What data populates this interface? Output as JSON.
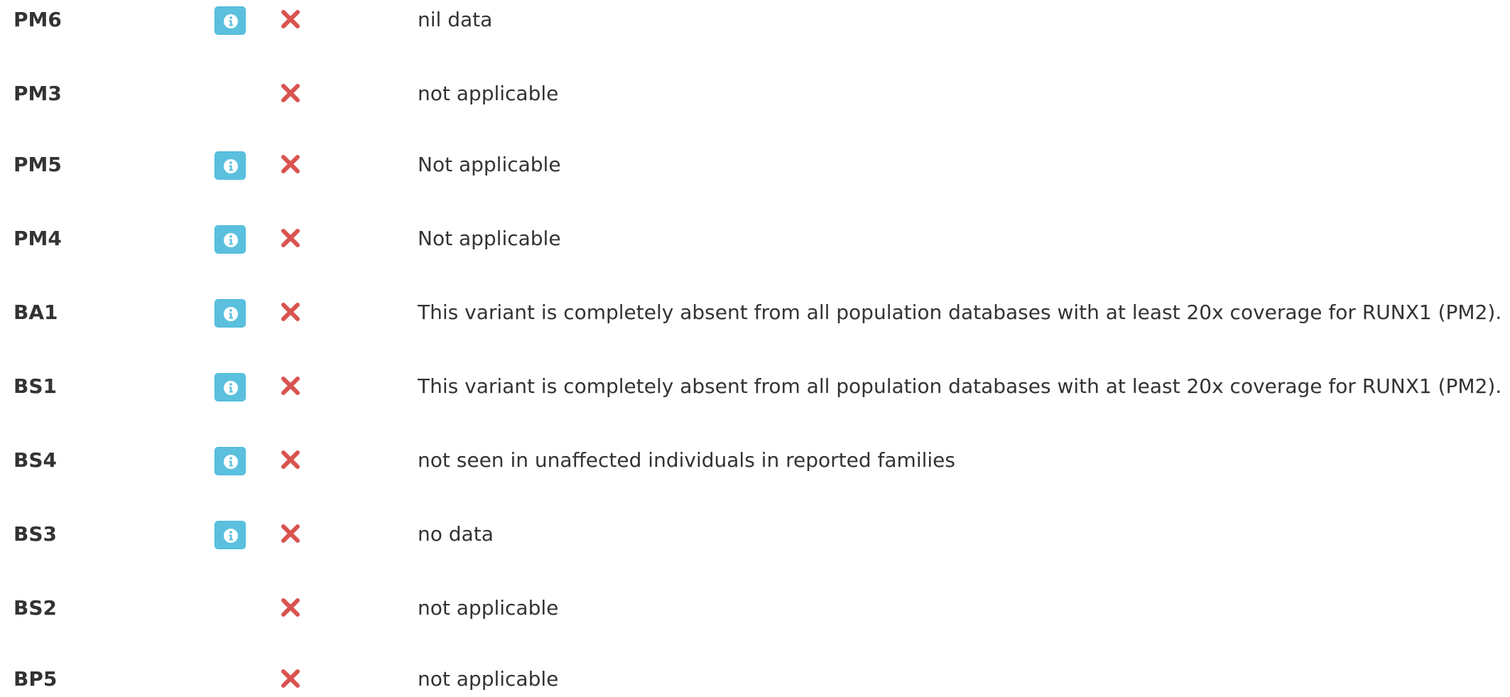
{
  "colors": {
    "info_button": "#5bc0de",
    "cross_icon": "#d9534f",
    "text": "#333333"
  },
  "criteria": [
    {
      "code": "PM6",
      "has_info": true,
      "met": false,
      "status_icon": "cross-icon",
      "description": "nil data"
    },
    {
      "code": "PM3",
      "has_info": false,
      "met": false,
      "status_icon": "cross-icon",
      "description": "not applicable"
    },
    {
      "code": "PM5",
      "has_info": true,
      "met": false,
      "status_icon": "cross-icon",
      "description": "Not applicable"
    },
    {
      "code": "PM4",
      "has_info": true,
      "met": false,
      "status_icon": "cross-icon",
      "description": "Not applicable"
    },
    {
      "code": "BA1",
      "has_info": true,
      "met": false,
      "status_icon": "cross-icon",
      "description": "This variant is completely absent from all population databases with at least 20x coverage for RUNX1 (PM2)."
    },
    {
      "code": "BS1",
      "has_info": true,
      "met": false,
      "status_icon": "cross-icon",
      "description": "This variant is completely absent from all population databases with at least 20x coverage for RUNX1 (PM2)."
    },
    {
      "code": "BS4",
      "has_info": true,
      "met": false,
      "status_icon": "cross-icon",
      "description": "not seen in unaffected individuals in reported families"
    },
    {
      "code": "BS3",
      "has_info": true,
      "met": false,
      "status_icon": "cross-icon",
      "description": "no data"
    },
    {
      "code": "BS2",
      "has_info": false,
      "met": false,
      "status_icon": "cross-icon",
      "description": "not applicable"
    },
    {
      "code": "BP5",
      "has_info": false,
      "met": false,
      "status_icon": "cross-icon",
      "description": "not applicable"
    }
  ]
}
